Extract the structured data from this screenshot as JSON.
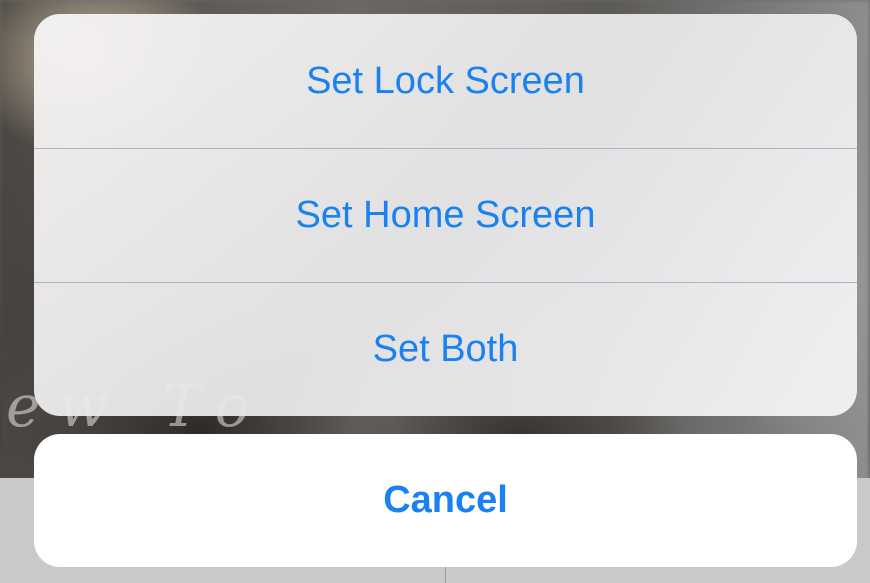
{
  "action_sheet": {
    "actions": [
      {
        "label": "Set Lock Screen"
      },
      {
        "label": "Set Home Screen"
      },
      {
        "label": "Set Both"
      }
    ],
    "cancel_label": "Cancel",
    "accent_color": "#1a82f0"
  }
}
